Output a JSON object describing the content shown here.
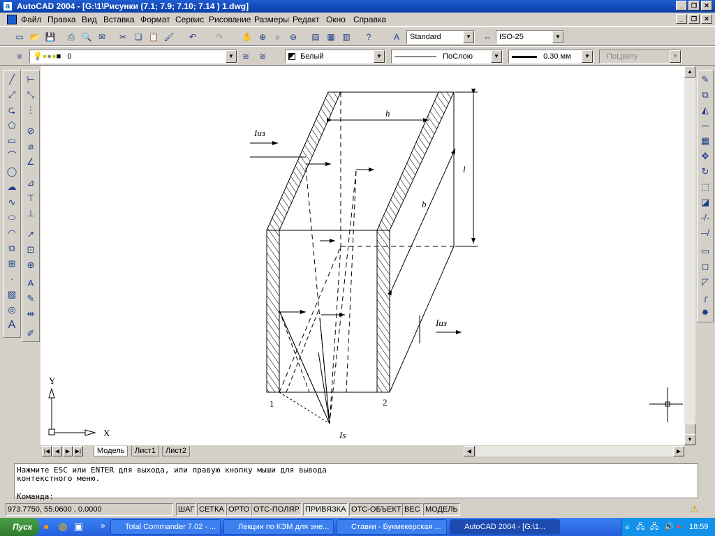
{
  "window": {
    "title": "AutoCAD 2004 - [G:\\1\\Рисунки (7.1; 7.9; 7.10; 7.14 ) 1.dwg]"
  },
  "menu": [
    "Файл",
    "Правка",
    "Вид",
    "Вставка",
    "Формат",
    "Сервис",
    "Рисование",
    "Размеры",
    "Редакт",
    "Окно",
    "Справка"
  ],
  "toolbar": {
    "text_style": "Standard",
    "dim_style": "ISO-25"
  },
  "properties": {
    "layer": "0",
    "color": "Белый",
    "linetype": "ПоСлою",
    "lineweight": "0.30 мм",
    "plotstyle": "ПоЦвету"
  },
  "drawing": {
    "labels": {
      "iiz_top": "Iиз",
      "iiz_bottom": "Iиз",
      "h": "h",
      "l": "l",
      "b": "b",
      "plate1": "1",
      "plate2": "2",
      "is": "Is"
    }
  },
  "ucs": {
    "x": "X",
    "y": "Y"
  },
  "tabs": [
    "Модель",
    "Лист1",
    "Лист2"
  ],
  "command": {
    "line1": "Нажмите ESC или ENTER для выхода, или правую кнопку мыши для вывода",
    "line2": "контекстного меню.",
    "prompt": "Команда:"
  },
  "status": {
    "coords": "973.7750, 55.0600 , 0.0000",
    "buttons": [
      "ШАГ",
      "СЕТКА",
      "ОРТО",
      "ОТС-ПОЛЯР",
      "ПРИВЯЗКА",
      "ОТС-ОБЪЕКТ",
      "ВЕС",
      "МОДЕЛЬ"
    ]
  },
  "taskbar": {
    "start": "Пуск",
    "tasks": [
      "Total Commander 7.02 - ...",
      "Лекции по КЭМ для эне...",
      "Ставки - Букмекерская ...",
      "AutoCAD 2004 - [G:\\1..."
    ],
    "time": "18:59"
  }
}
